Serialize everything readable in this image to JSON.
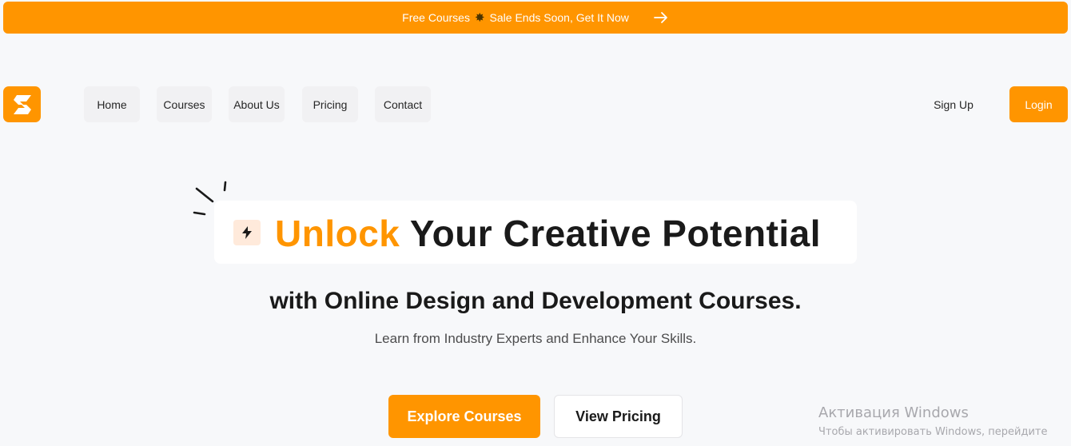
{
  "banner": {
    "text_before": "Free Courses",
    "burst_icon": "✸",
    "text_after": "Sale Ends Soon, Get It Now",
    "arrow_icon": "arrow-right-icon"
  },
  "header": {
    "logo_icon": "brand-logo-icon",
    "nav": [
      {
        "label": "Home"
      },
      {
        "label": "Courses"
      },
      {
        "label": "About Us"
      },
      {
        "label": "Pricing"
      },
      {
        "label": "Contact"
      }
    ],
    "signup_label": "Sign Up",
    "login_label": "Login"
  },
  "hero": {
    "headline_accent": "Unlock",
    "headline_rest": "Your Creative Potential",
    "subheadline": "with Online Design and Development Courses.",
    "description": "Learn from Industry Experts and Enhance Your Skills.",
    "primary_cta": "Explore Courses",
    "secondary_cta": "View Pricing"
  },
  "watermark": {
    "title": "Активация Windows",
    "line": "Чтобы активировать Windows, перейдите"
  },
  "colors": {
    "accent": "#ff9500",
    "background": "#f7f8fa",
    "text": "#262626"
  }
}
